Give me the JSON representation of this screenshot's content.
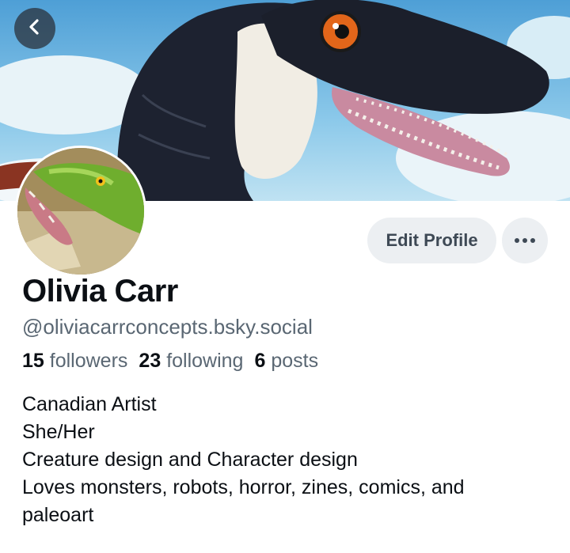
{
  "profile": {
    "display_name": "Olivia Carr",
    "handle": "@oliviacarrconcepts.bsky.social",
    "followers_count": "15",
    "followers_label": "followers",
    "following_count": "23",
    "following_label": "following",
    "posts_count": "6",
    "posts_label": "posts",
    "bio_lines": [
      "Canadian Artist",
      "She/Her",
      "Creature design and Character design",
      "Loves monsters, robots, horror, zines, comics, and",
      "paleoart"
    ]
  },
  "actions": {
    "edit_profile_label": "Edit Profile"
  },
  "icons": {
    "back": "chevron-left-icon",
    "more": "ellipsis-icon"
  },
  "colors": {
    "button_bg": "#eceff2",
    "muted_text": "#5a6773",
    "primary_text": "#0b0f14"
  }
}
